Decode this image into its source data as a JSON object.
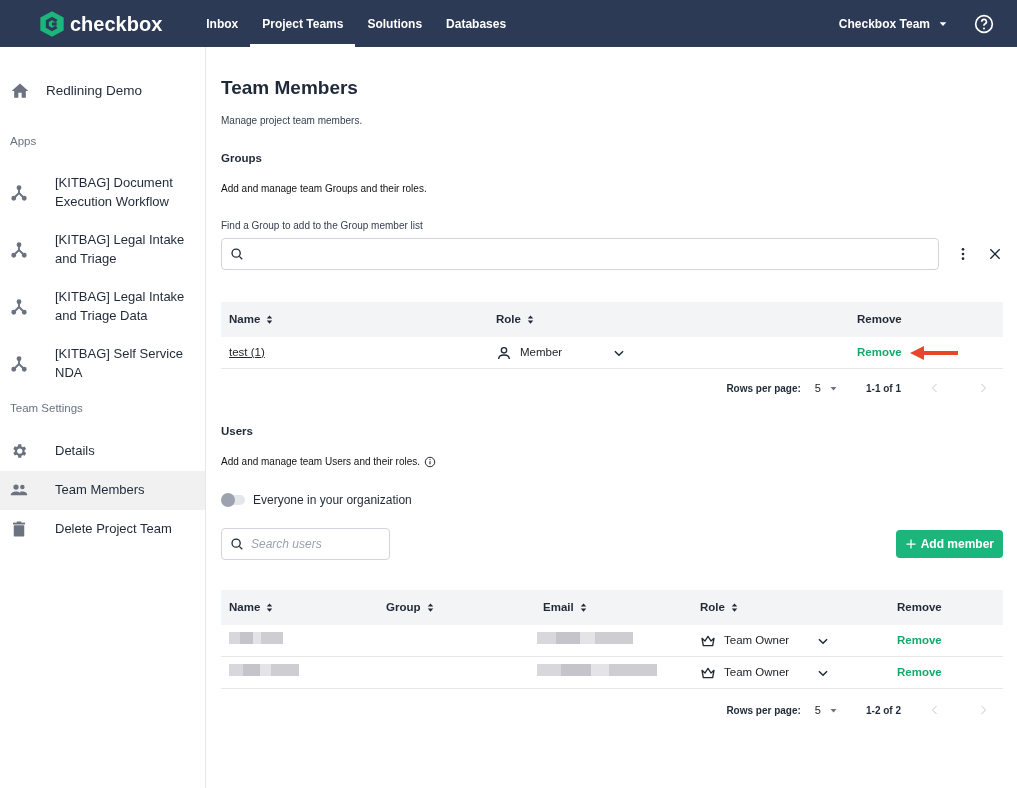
{
  "navbar": {
    "brand": "checkbox",
    "links": [
      {
        "label": "Inbox",
        "selected": false
      },
      {
        "label": "Project Teams",
        "selected": true
      },
      {
        "label": "Solutions",
        "selected": false
      },
      {
        "label": "Databases",
        "selected": false
      }
    ],
    "team_menu": "Checkbox Team"
  },
  "sidebar": {
    "top": {
      "label": "Redlining Demo",
      "kind": "home"
    },
    "sections": [
      {
        "title": "Apps",
        "items": [
          {
            "label": "[KITBAG] Document Execution Workflow",
            "kind": "workflow",
            "selected": false
          },
          {
            "label": "[KITBAG] Legal Intake and Triage",
            "kind": "workflow",
            "selected": false
          },
          {
            "label": "[KITBAG] Legal Intake and Triage Data",
            "kind": "workflow",
            "selected": false
          },
          {
            "label": "[KITBAG] Self Service NDA",
            "kind": "workflow",
            "selected": false
          }
        ]
      },
      {
        "title": "Team Settings",
        "items": [
          {
            "label": "Details",
            "kind": "gear",
            "selected": false
          },
          {
            "label": "Team Members",
            "kind": "people",
            "selected": true
          },
          {
            "label": "Delete Project Team",
            "kind": "trash",
            "selected": false
          }
        ]
      }
    ]
  },
  "page": {
    "title": "Team Members",
    "subtitle": "Manage project team members."
  },
  "groups": {
    "heading": "Groups",
    "description": "Add and manage team Groups and their roles.",
    "search_label": "Find a Group to add to the Group member list",
    "table": {
      "columns": [
        {
          "label": "Name",
          "sortable": true
        },
        {
          "label": "Role",
          "sortable": true
        },
        {
          "label": "Remove",
          "sortable": false
        }
      ],
      "rows": [
        {
          "name": "test (1)",
          "role": "Member",
          "kind": "person",
          "remove": "Remove",
          "annotated": true
        }
      ]
    },
    "pagination": {
      "rows_label": "Rows per page:",
      "rows_value": "5",
      "range": "1-1 of 1"
    }
  },
  "users": {
    "heading": "Users",
    "description": "Add and manage team Users and their roles.",
    "toggle": {
      "label": "Everyone in your organization",
      "on": false
    },
    "search": {
      "placeholder": "Search users"
    },
    "add_button": "Add member",
    "table": {
      "columns": [
        {
          "label": "Name",
          "sortable": true
        },
        {
          "label": "Group",
          "sortable": true
        },
        {
          "label": "Email",
          "sortable": true
        },
        {
          "label": "Role",
          "sortable": true
        },
        {
          "label": "Remove",
          "sortable": false
        }
      ],
      "rows": [
        {
          "role": "Team Owner",
          "kind": "crown",
          "remove": "Remove"
        },
        {
          "role": "Team Owner",
          "kind": "crown",
          "remove": "Remove"
        }
      ]
    },
    "pagination": {
      "rows_label": "Rows per page:",
      "rows_value": "5",
      "range": "1-2 of 2"
    }
  }
}
